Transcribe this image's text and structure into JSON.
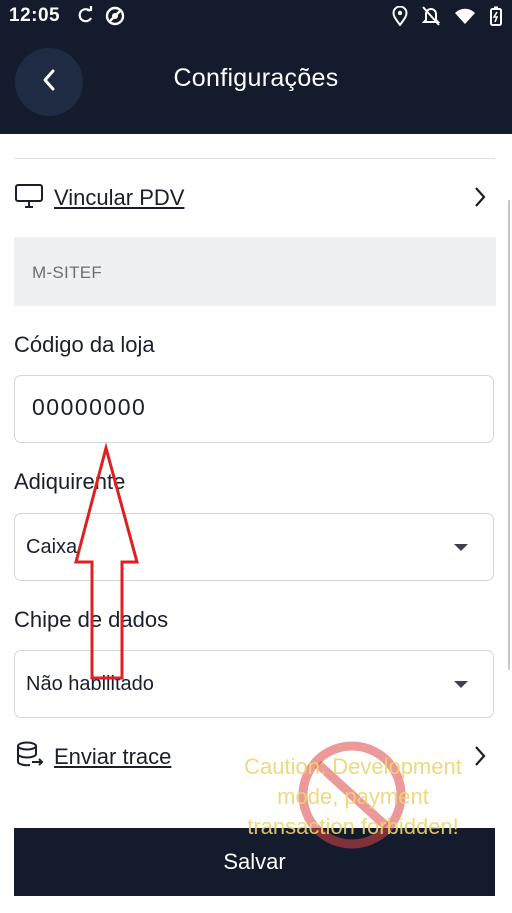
{
  "status_bar": {
    "time": "12:05",
    "left_icons": [
      "sync-icon",
      "no-disturb-icon"
    ],
    "right_icons": [
      "location-icon",
      "notifications-off-icon",
      "wifi-icon",
      "battery-icon"
    ]
  },
  "header": {
    "title": "Configurações",
    "back_icon": "chevron-left-icon"
  },
  "vincular_pdv": {
    "label": "Vincular PDV",
    "icon": "monitor-icon"
  },
  "pdv_value": "M-SITEF",
  "store_code": {
    "label": "Código da loja",
    "value": "00000000"
  },
  "acquirer": {
    "label": "Adiquirente",
    "value": "Caixa"
  },
  "data_chip": {
    "label": "Chipe de dados",
    "value": "Não habilitado"
  },
  "send_trace": {
    "label": "Enviar trace",
    "icon": "database-export-icon"
  },
  "save_button": {
    "label": "Salvar"
  },
  "watermark": {
    "text": "Caution: Development mode, payment transaction forbidden!"
  },
  "colors": {
    "primary_dark": "#131b2c",
    "annotation_red": "#e02020",
    "watermark_yellow": "#ecd66e"
  }
}
